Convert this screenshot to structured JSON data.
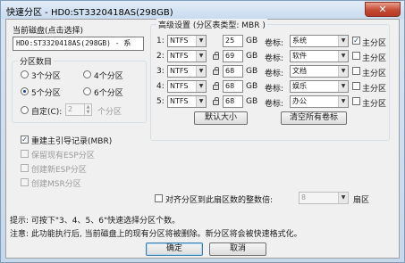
{
  "window": {
    "title": "快速分区 - HD0:ST3320418AS(298GB)",
    "close_glyph": "✕"
  },
  "disk": {
    "group_label": "当前磁盘(点击选择)",
    "selected": "HD0:ST3320418AS(298GB) - 系"
  },
  "count": {
    "group_label": "分区数目",
    "options": [
      "3个分区",
      "4个分区",
      "5个分区",
      "6个分区"
    ],
    "selected_index": 2,
    "custom_label": "自定(C):",
    "custom_value": "2",
    "custom_unit": "个分区"
  },
  "options": {
    "rebuild_mbr": {
      "label": "重建主引导记录(MBR)",
      "checked": true
    },
    "keep_esp": "保留现有ESP分区",
    "new_esp": "创建新ESP分区",
    "new_msr": "创建MSR分区"
  },
  "advanced": {
    "group_label": "高级设置 (分区表类型: MBR )",
    "volume_label_text": "卷标:",
    "primary_label": "主分区",
    "size_unit": "GB",
    "rows": [
      {
        "num": "1:",
        "fs": "NTFS",
        "size": "25",
        "locked": false,
        "volume": "系统",
        "primary": true
      },
      {
        "num": "2:",
        "fs": "NTFS",
        "size": "69",
        "locked": true,
        "volume": "软件",
        "primary": false
      },
      {
        "num": "3:",
        "fs": "NTFS",
        "size": "68",
        "locked": true,
        "volume": "文档",
        "primary": false
      },
      {
        "num": "4:",
        "fs": "NTFS",
        "size": "68",
        "locked": true,
        "volume": "娱乐",
        "primary": false
      },
      {
        "num": "5:",
        "fs": "NTFS",
        "size": "68",
        "locked": true,
        "volume": "办公",
        "primary": false
      }
    ],
    "default_size_button": "默认大小",
    "clear_labels_button": "清空所有卷标"
  },
  "align": {
    "label": "对齐分区到此扇区数的整数倍:",
    "value": "8",
    "unit": "扇区"
  },
  "hints": {
    "tip": "提示: 可按下\"3、4、5、6\"快速选择分区个数。",
    "warning": "注意: 此功能执行后, 当前磁盘上的现有分区将被删除。新分区将会被快速格式化。"
  },
  "buttons": {
    "ok": "确定",
    "cancel": "取消"
  }
}
